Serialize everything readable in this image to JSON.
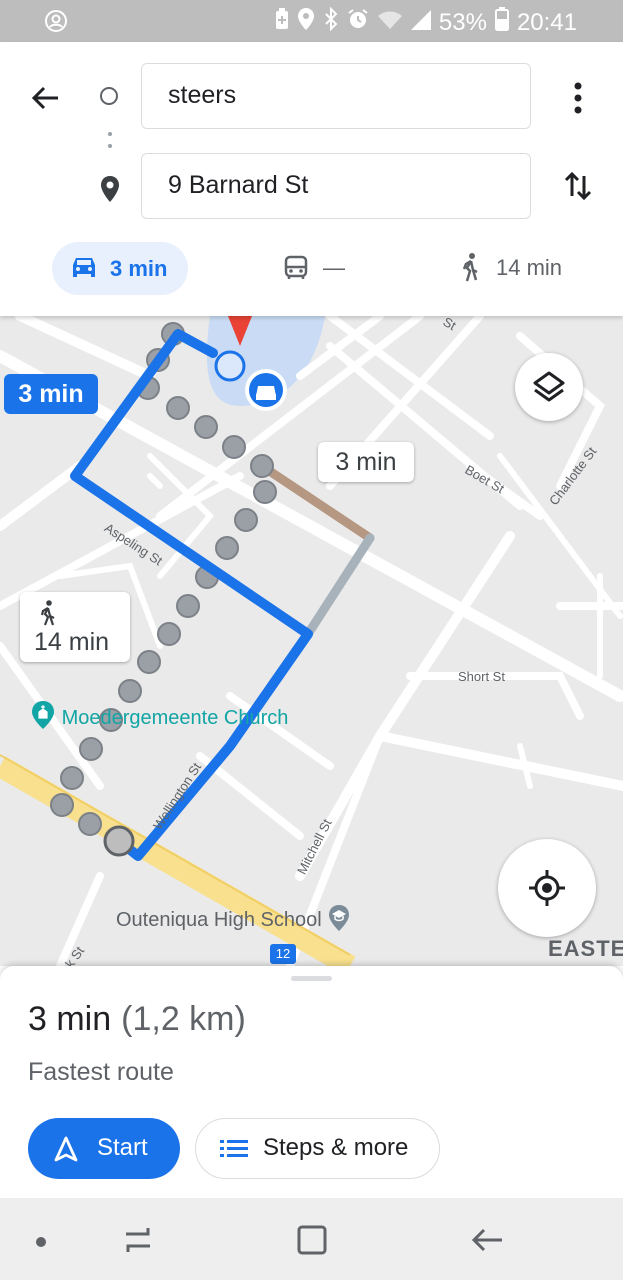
{
  "status_bar": {
    "battery": "53%",
    "time": "20:41",
    "icons": [
      "account-circle-icon",
      "battery-saver-icon",
      "location-icon",
      "bluetooth-icon",
      "alarm-icon",
      "wifi-icon",
      "signal-icon",
      "battery-icon"
    ]
  },
  "directions": {
    "origin": "steers",
    "destination": "9 Barnard St"
  },
  "modes": {
    "drive": "3 min",
    "transit": "—",
    "walk": "14 min"
  },
  "map": {
    "callout_main": "3 min",
    "callout_alt": "3 min",
    "callout_walk": "14 min",
    "streets": {
      "aspeling": "Aspeling St",
      "wellington": "Wellington St",
      "mitchell": "Mitchell St",
      "short": "Short St",
      "boet": "Boet St",
      "charlotte": "Charlotte St",
      "top_partial": "St",
      "bottom_partial": "k St"
    },
    "poi_church": "Moedergemeente Church",
    "poi_school": "Outeniqua High School",
    "route_shield": "12",
    "area_label": "EASTE"
  },
  "sheet": {
    "duration": "3 min",
    "distance": "(1,2 km)",
    "subtitle": "Fastest route",
    "start_label": "Start",
    "steps_label": "Steps & more"
  },
  "colors": {
    "accent": "#1a73e8",
    "route_alt": "#a8b2ba",
    "traffic_slow": "#b59782",
    "status_bar": "#bdbdbd"
  }
}
